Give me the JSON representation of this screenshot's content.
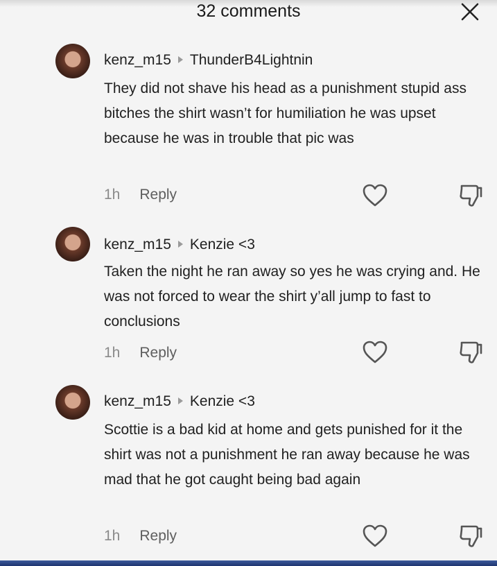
{
  "header": {
    "title": "32 comments"
  },
  "comments": [
    {
      "username": "kenz_m15",
      "reply_to": "ThunderB4Lightnin",
      "text": "They did not shave his head as a punishment stupid ass bitches the shirt wasn’t for humiliation he was upset because he was in trouble that pic was",
      "time": "1h",
      "reply_label": "Reply"
    },
    {
      "username": "kenz_m15",
      "reply_to": "Kenzie <3",
      "text": "Taken the night he ran away so yes he was crying and. He was not forced to wear the shirt y’all jump to fast to conclusions",
      "time": "1h",
      "reply_label": "Reply"
    },
    {
      "username": "kenz_m15",
      "reply_to": "Kenzie <3",
      "text": "Scottie is a bad kid at home and gets punished for it the shirt was not a punishment he ran away because he was mad that he got caught being bad again",
      "time": "1h",
      "reply_label": "Reply"
    }
  ]
}
